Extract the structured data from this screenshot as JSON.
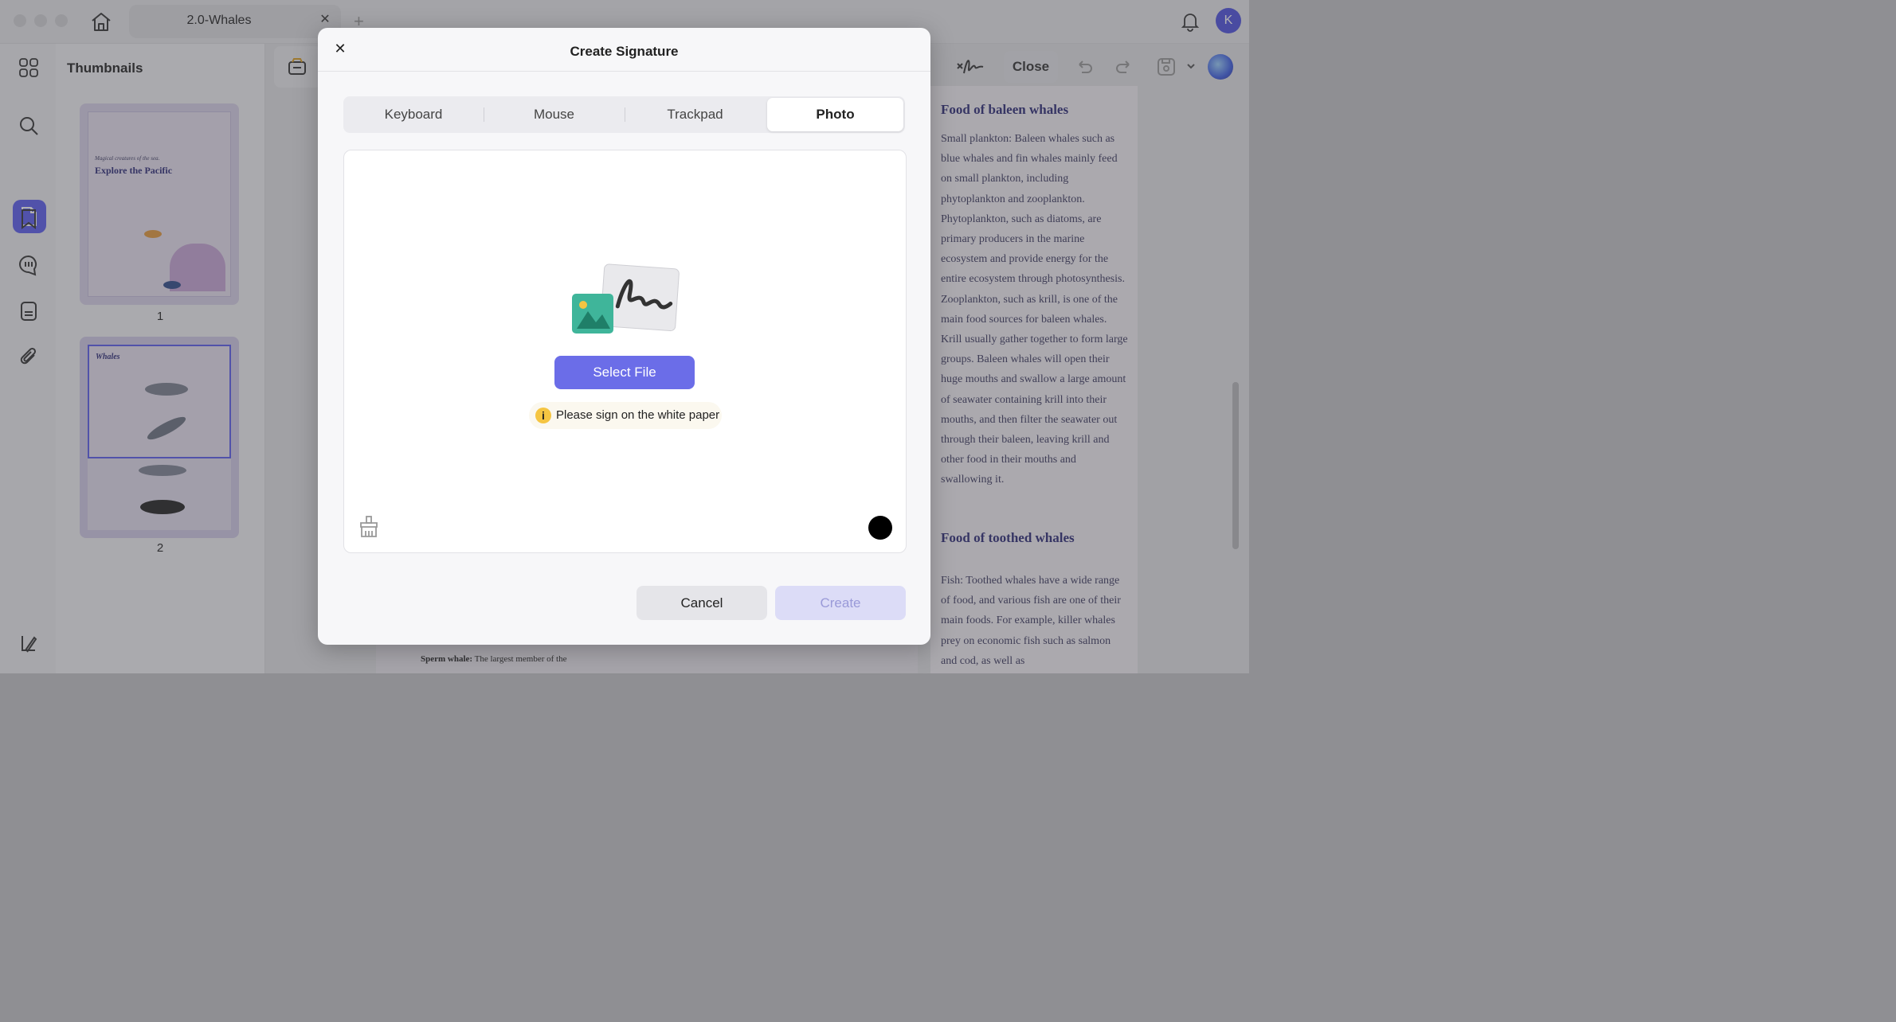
{
  "titlebar": {
    "tab_title": "2.0-Whales",
    "tab_close": "✕",
    "tab_add": "+",
    "avatar_initial": "K"
  },
  "sidebar": {
    "title": "Thumbnails",
    "pages": [
      {
        "number": "1",
        "heading": "Explore the Pacific",
        "subheading": "Magical creatures of the sea."
      },
      {
        "number": "2",
        "heading": "Whales"
      }
    ]
  },
  "toolbar": {
    "close_label": "Close"
  },
  "document": {
    "heading1": "Food of baleen whales",
    "para1": "Small plankton: Baleen whales such as blue whales and fin whales mainly feed on small plankton, including phytoplankton and zooplankton. Phytoplankton, such as diatoms, are primary producers in the marine ecosystem and provide energy for the entire ecosystem through photosynthesis. Zooplankton, such as krill, is one of the main food sources for baleen whales. Krill usually gather together to form large groups. Baleen whales will open their huge mouths and swallow a large amount of seawater containing krill into their mouths, and then filter the seawater out through their baleen, leaving krill and other food in their mouths and swallowing it.",
    "heading2": "Food of toothed whales",
    "para2": "Fish: Toothed whales have a wide range of food, and various fish are one of their main foods. For example, killer whales prey on economic fish such as salmon and cod, as well as",
    "bottom_bold": "Sperm whale:",
    "bottom_text": " The largest member of the"
  },
  "modal": {
    "title": "Create Signature",
    "close": "✕",
    "tabs": [
      {
        "label": "Keyboard",
        "active": false
      },
      {
        "label": "Mouse",
        "active": false
      },
      {
        "label": "Trackpad",
        "active": false
      },
      {
        "label": "Photo",
        "active": true
      }
    ],
    "select_file": "Select File",
    "hint": "Please sign on the white paper",
    "hint_icon": "i",
    "cancel": "Cancel",
    "create": "Create",
    "ink_color": "#000000",
    "accent_color": "#6b6de8"
  }
}
